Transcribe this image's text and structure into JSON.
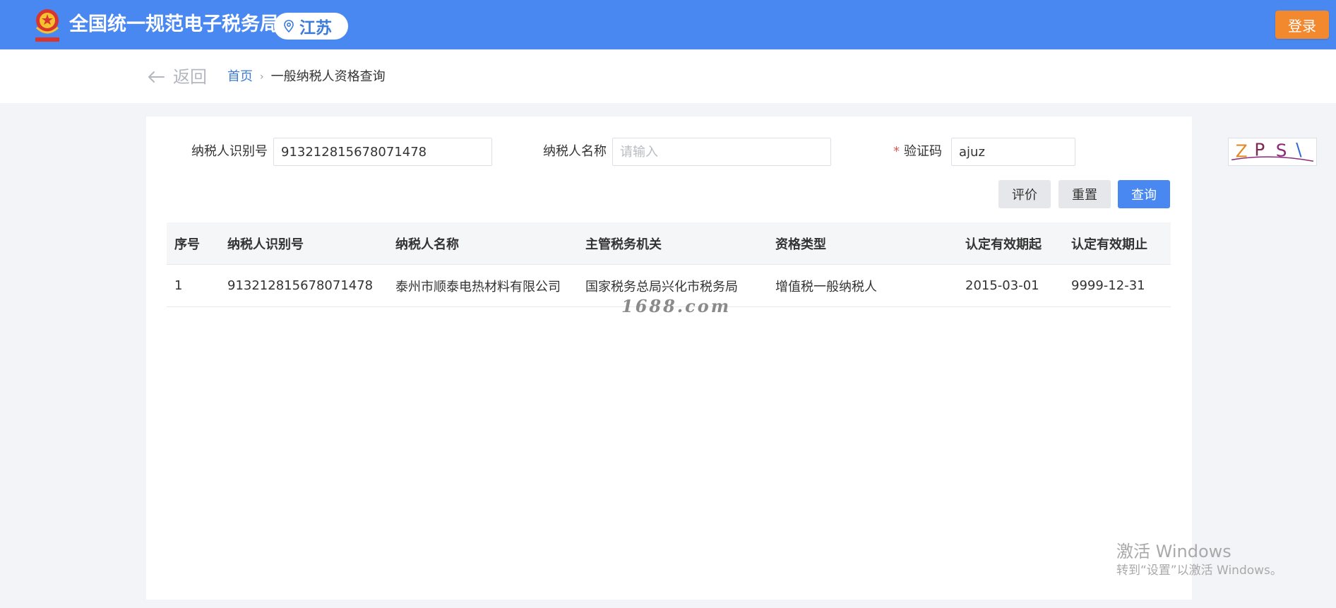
{
  "header": {
    "title": "全国统一规范电子税务局",
    "region": "江苏",
    "login_label": "登录",
    "colors": {
      "bar": "#4a88f1",
      "login": "#f2892f"
    }
  },
  "nav": {
    "back_label": "返回",
    "breadcrumb": {
      "home": "首页",
      "separator": "›",
      "current": "一般纳税人资格查询"
    }
  },
  "form": {
    "taxpayer_id": {
      "label": "纳税人识别号",
      "value": "913212815678071478"
    },
    "taxpayer_name": {
      "label": "纳税人名称",
      "value": "",
      "placeholder": "请输入"
    },
    "captcha": {
      "required_mark": "*",
      "label": "验证码",
      "value": "ajuz",
      "image_text": "ZPS\\"
    },
    "buttons": {
      "evaluate": "评价",
      "reset": "重置",
      "query": "查询"
    }
  },
  "table": {
    "headers": [
      "序号",
      "纳税人识别号",
      "纳税人名称",
      "主管税务机关",
      "资格类型",
      "认定有效期起",
      "认定有效期止"
    ],
    "rows": [
      [
        "1",
        "913212815678071478",
        "泰州市顺泰电热材料有限公司",
        "国家税务总局兴化市税务局",
        "增值税一般纳税人",
        "2015-03-01",
        "9999-12-31"
      ]
    ]
  },
  "watermark": "1688.com",
  "windows_activation": {
    "title": "激活 Windows",
    "subtitle": "转到“设置”以激活 Windows。"
  }
}
